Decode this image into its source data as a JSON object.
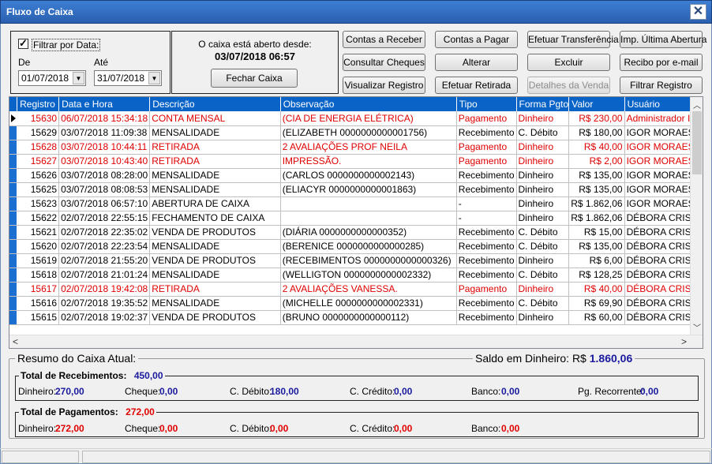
{
  "window": {
    "title": "Fluxo de Caixa"
  },
  "filter": {
    "checkbox_label": "Filtrar por Data:",
    "de_label": "De",
    "ate_label": "Até",
    "de_value": "01/07/2018",
    "ate_value": "31/07/2018"
  },
  "caixa": {
    "status_text": "O caixa está aberto desde:",
    "opened_at": "03/07/2018 06:57",
    "close_button": "Fechar Caixa"
  },
  "actions": {
    "contas_receber": "Contas a Receber",
    "contas_pagar": "Contas a Pagar",
    "efetuar_transferencia": "Efetuar Transferência",
    "imp_ultima_abertura": "Imp. Última Abertura",
    "consultar_cheques": "Consultar Cheques",
    "alterar": "Alterar",
    "excluir": "Excluir",
    "recibo_email": "Recibo por e-mail",
    "visualizar_registro": "Visualizar Registro",
    "efetuar_retirada": "Efetuar Retirada",
    "detalhes_venda": "Detalhes da Venda",
    "filtrar_registro": "Filtrar Registro"
  },
  "table": {
    "columns": [
      "Registro",
      "Data e Hora",
      "Descrição",
      "Observação",
      "Tipo",
      "Forma Pgto",
      "Valor",
      "Usuário"
    ],
    "rows": [
      {
        "reg": "15630",
        "dt": "06/07/2018 15:34:18",
        "desc": "CONTA MENSAL",
        "obs": "(CIA DE ENERGIA ELÉTRICA)",
        "tipo": "Pagamento",
        "forma": "Dinheiro",
        "valor": "R$ 230,00",
        "user": "Administrador Ins",
        "red": true
      },
      {
        "reg": "15629",
        "dt": "03/07/2018 11:09:38",
        "desc": "MENSALIDADE",
        "obs": "(ELIZABETH 0000000000001756)",
        "tipo": "Recebimento",
        "forma": "C. Débito",
        "valor": "R$ 180,00",
        "user": "IGOR MORAES",
        "red": false
      },
      {
        "reg": "15628",
        "dt": "03/07/2018 10:44:11",
        "desc": "RETIRADA",
        "obs": "2 AVALIAÇÕES PROF NEILA",
        "tipo": "Pagamento",
        "forma": "Dinheiro",
        "valor": "R$ 40,00",
        "user": "IGOR MORAES",
        "red": true
      },
      {
        "reg": "15627",
        "dt": "03/07/2018 10:43:40",
        "desc": "RETIRADA",
        "obs": "IMPRESSÃO.",
        "tipo": "Pagamento",
        "forma": "Dinheiro",
        "valor": "R$ 2,00",
        "user": "IGOR MORAES",
        "red": true
      },
      {
        "reg": "15626",
        "dt": "03/07/2018 08:28:00",
        "desc": "MENSALIDADE",
        "obs": "(CARLOS 0000000000002143)",
        "tipo": "Recebimento",
        "forma": "Dinheiro",
        "valor": "R$ 135,00",
        "user": "IGOR MORAES",
        "red": false
      },
      {
        "reg": "15625",
        "dt": "03/07/2018 08:08:53",
        "desc": "MENSALIDADE",
        "obs": "(ELIACYR 0000000000001863)",
        "tipo": "Recebimento",
        "forma": "Dinheiro",
        "valor": "R$ 135,00",
        "user": "IGOR MORAES",
        "red": false
      },
      {
        "reg": "15623",
        "dt": "03/07/2018 06:57:10",
        "desc": "ABERTURA DE CAIXA",
        "obs": "",
        "tipo": "-",
        "forma": "Dinheiro",
        "valor": "R$ 1.862,06",
        "user": "IGOR MORAES",
        "red": false
      },
      {
        "reg": "15622",
        "dt": "02/07/2018 22:55:15",
        "desc": "FECHAMENTO DE CAIXA",
        "obs": "",
        "tipo": "-",
        "forma": "Dinheiro",
        "valor": "R$ 1.862,06",
        "user": "DÉBORA CRIST",
        "red": false
      },
      {
        "reg": "15621",
        "dt": "02/07/2018 22:35:02",
        "desc": "VENDA DE PRODUTOS",
        "obs": "(DIÁRIA 0000000000000352)",
        "tipo": "Recebimento",
        "forma": "C. Débito",
        "valor": "R$ 15,00",
        "user": "DÉBORA CRIST",
        "red": false
      },
      {
        "reg": "15620",
        "dt": "02/07/2018 22:23:54",
        "desc": "MENSALIDADE",
        "obs": "(BERENICE 0000000000000285)",
        "tipo": "Recebimento",
        "forma": "C. Débito",
        "valor": "R$ 135,00",
        "user": "DÉBORA CRIST",
        "red": false
      },
      {
        "reg": "15619",
        "dt": "02/07/2018 21:55:20",
        "desc": "VENDA DE PRODUTOS",
        "obs": "(RECEBIMENTOS 0000000000000326)",
        "tipo": "Recebimento",
        "forma": "Dinheiro",
        "valor": "R$ 6,00",
        "user": "DÉBORA CRIST",
        "red": false
      },
      {
        "reg": "15618",
        "dt": "02/07/2018 21:01:24",
        "desc": "MENSALIDADE",
        "obs": "(WELLIGTON 0000000000002332)",
        "tipo": "Recebimento",
        "forma": "C. Débito",
        "valor": "R$ 128,25",
        "user": "DÉBORA CRIST",
        "red": false
      },
      {
        "reg": "15617",
        "dt": "02/07/2018 19:42:08",
        "desc": "RETIRADA",
        "obs": "2 AVALIAÇÕES VANESSA.",
        "tipo": "Pagamento",
        "forma": "Dinheiro",
        "valor": "R$ 40,00",
        "user": "DÉBORA CRIST",
        "red": true
      },
      {
        "reg": "15616",
        "dt": "02/07/2018 19:35:52",
        "desc": "MENSALIDADE",
        "obs": "(MICHELLE 0000000000002331)",
        "tipo": "Recebimento",
        "forma": "C. Débito",
        "valor": "R$ 69,90",
        "user": "DÉBORA CRIST",
        "red": false
      },
      {
        "reg": "15615",
        "dt": "02/07/2018 19:02:37",
        "desc": "VENDA DE PRODUTOS",
        "obs": "(BRUNO 0000000000000112)",
        "tipo": "Recebimento",
        "forma": "Dinheiro",
        "valor": "R$ 60,00",
        "user": "DÉBORA CRIST",
        "red": false
      }
    ]
  },
  "summary": {
    "title": "Resumo do Caixa Atual:",
    "saldo_label": "Saldo em Dinheiro: R$",
    "saldo_value": "1.860,06",
    "receb": {
      "label": "Total de Recebimentos:",
      "total": "450,00",
      "dinheiro_l": "Dinheiro:",
      "dinheiro": "270,00",
      "cheque_l": "Cheque:",
      "cheque": "0,00",
      "cdebito_l": "C. Débito:",
      "cdebito": "180,00",
      "ccredito_l": "C. Crédito:",
      "ccredito": "0,00",
      "banco_l": "Banco:",
      "banco": "0,00",
      "pgrec_l": "Pg. Recorrente:",
      "pgrec": "0,00"
    },
    "pagto": {
      "label": "Total de Pagamentos:",
      "total": "272,00",
      "dinheiro_l": "Dinheiro:",
      "dinheiro": "272,00",
      "cheque_l": "Cheque:",
      "cheque": "0,00",
      "cdebito_l": "C. Débito:",
      "cdebito": "0,00",
      "ccredito_l": "C. Crédito:",
      "ccredito": "0,00",
      "banco_l": "Banco:",
      "banco": "0,00"
    }
  }
}
